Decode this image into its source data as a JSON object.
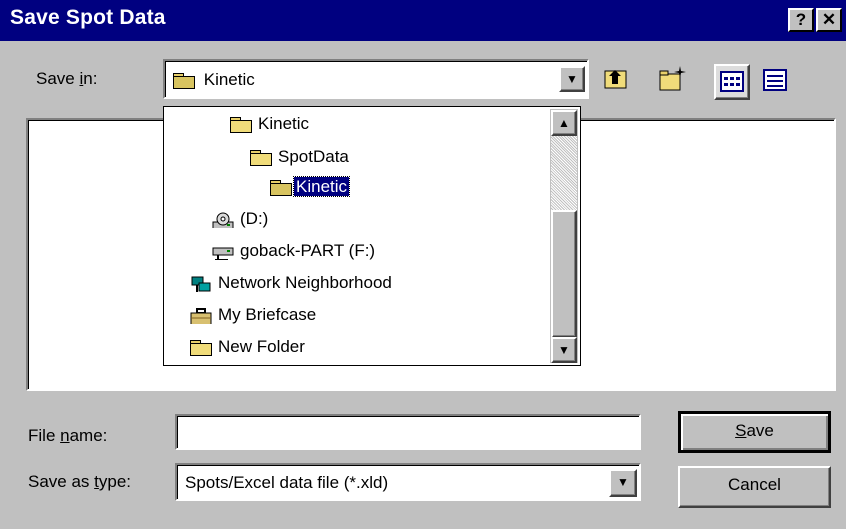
{
  "window": {
    "title": "Save Spot Data",
    "help_glyph": "?",
    "close_glyph": "✕"
  },
  "save_in": {
    "label_pre": "Save ",
    "label_ul": "i",
    "label_post": "n:",
    "value": "Kinetic",
    "items": [
      {
        "label": "Kinetic",
        "icon": "folder-icon"
      },
      {
        "label": "SpotData",
        "icon": "folder-icon"
      },
      {
        "label": "Kinetic",
        "icon": "open-folder-icon",
        "selected": true
      },
      {
        "label": "(D:)",
        "icon": "cd-drive-icon"
      },
      {
        "label": "goback-PART (F:)",
        "icon": "network-drive-icon"
      },
      {
        "label": "Network Neighborhood",
        "icon": "network-neighborhood-icon"
      },
      {
        "label": "My Briefcase",
        "icon": "briefcase-icon"
      },
      {
        "label": "New Folder",
        "icon": "folder-icon"
      }
    ]
  },
  "toolbar": {
    "icons": [
      "up-one-level-icon",
      "create-new-folder-icon",
      "list-view-icon",
      "details-view-icon"
    ]
  },
  "file_name": {
    "label_pre": "File ",
    "label_ul": "n",
    "label_post": "ame:",
    "value": ""
  },
  "save_as_type": {
    "label_pre": "Save as ",
    "label_ul": "t",
    "label_post": "ype:",
    "value": "Spots/Excel data file (*.xld)"
  },
  "buttons": {
    "save": {
      "ul": "S",
      "rest": "ave"
    },
    "cancel": "Cancel"
  },
  "colors": {
    "titlebar": "#000080",
    "face": "#c0c0c0",
    "selection": "#000080"
  }
}
